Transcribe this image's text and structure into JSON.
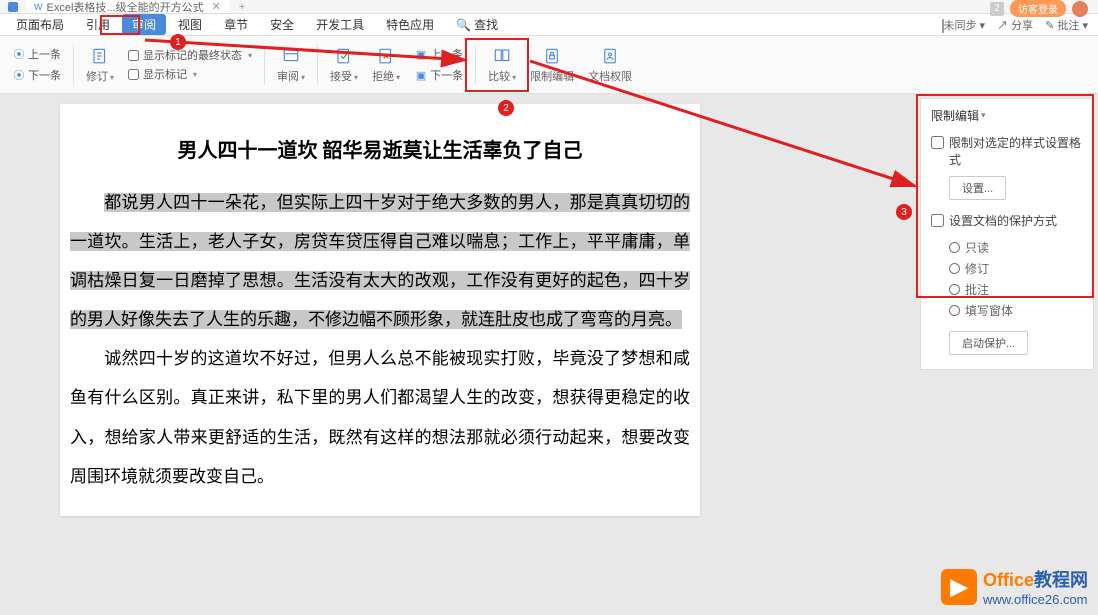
{
  "tabs": {
    "active_tab": "Excel表格技...级全能的开方公式",
    "plus": "+",
    "notif_count": "2",
    "guest_login": "访客登录"
  },
  "menu": {
    "items": [
      "页面布局",
      "引用",
      "审阅",
      "视图",
      "章节",
      "安全",
      "开发工具",
      "特色应用"
    ],
    "search": "查找",
    "sync": "未同步",
    "share": "分享",
    "annotate": "批注"
  },
  "ribbon": {
    "show_final": "显示标记的最终状态",
    "show_marks": "显示标记",
    "revise": "修订",
    "review": "审阅",
    "accept": "接受",
    "reject": "拒绝",
    "prev": "上一条",
    "next": "下一条",
    "compare": "比较",
    "restrict": "限制编辑",
    "doc_perm": "文档权限",
    "small_prev": "上一条",
    "small_next": "下一条"
  },
  "panel": {
    "title": "限制编辑",
    "check1": "限制对选定的样式设置格式",
    "btn1": "设置...",
    "check2": "设置文档的保护方式",
    "radio1": "只读",
    "radio2": "修订",
    "radio3": "批注",
    "radio4": "填写窗体",
    "btn2": "启动保护..."
  },
  "doc": {
    "title": "男人四十一道坎 韶华易逝莫让生活辜负了自己",
    "p1a": "都说男人四十一朵花，但实际上四十岁对于绝大多数的男人，那是真真切切的一道坎。生活上，老人子女，房贷车贷压得自己难以喘息；工作上，平平庸庸，单调枯燥日复一日磨掉了思想。",
    "p1b": "生活没有太大的改观，工作没有更好的起色，四十岁的男人好像失去了人生的乐趣，不修边幅不顾形象，就连肚皮也成了弯弯的月亮。",
    "p2": "诚然四十岁的这道坎不好过，但男人么总不能被现实打败，毕竟没了梦想和咸鱼有什么区别。真正来讲，私下里的男人们都渴望人生的改变，想获得更稳定的收入，想给家人带来更舒适的生活，既然有这样的想法那就必须行动起来，想要改变周围环境就须要改变自己。"
  },
  "watermark": {
    "brand1": "Office",
    "brand2": "教程网",
    "url": "www.office26.com"
  },
  "annot": {
    "n1": "1",
    "n2": "2",
    "n3": "3"
  }
}
